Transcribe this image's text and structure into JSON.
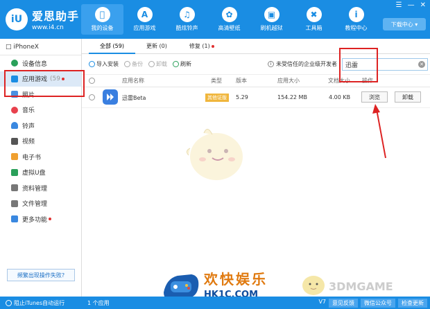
{
  "header": {
    "logo_badge": "iU",
    "logo_title": "爱思助手",
    "logo_url": "www.i4.cn",
    "nav": [
      {
        "label": "我的设备",
        "icon": "apple-icon"
      },
      {
        "label": "应用游戏",
        "icon": "app-store-icon"
      },
      {
        "label": "酷炫铃声",
        "icon": "bell-icon"
      },
      {
        "label": "高清壁纸",
        "icon": "flower-icon"
      },
      {
        "label": "刷机越狱",
        "icon": "box-icon"
      },
      {
        "label": "工具箱",
        "icon": "tools-icon"
      },
      {
        "label": "教程中心",
        "icon": "info-icon"
      }
    ],
    "download_center": "下载中心"
  },
  "sidebar": {
    "device": "iPhoneX",
    "items": [
      {
        "label": "设备信息",
        "icon": "info-icon",
        "color": "#2aa05a"
      },
      {
        "label": "应用游戏",
        "count": "(59",
        "icon": "app-icon",
        "color": "#1a8de3"
      },
      {
        "label": "照片",
        "icon": "photo-icon",
        "color": "#4a90e2"
      },
      {
        "label": "音乐",
        "icon": "music-icon",
        "color": "#e8414d"
      },
      {
        "label": "铃声",
        "icon": "bell-icon",
        "color": "#3a88e0"
      },
      {
        "label": "视频",
        "icon": "video-icon",
        "color": "#555555"
      },
      {
        "label": "电子书",
        "icon": "book-icon",
        "color": "#f0a030"
      },
      {
        "label": "虚拟U盘",
        "icon": "usb-icon",
        "color": "#2aa05a"
      },
      {
        "label": "资料管理",
        "icon": "contacts-icon",
        "color": "#777777"
      },
      {
        "label": "文件管理",
        "icon": "folder-icon",
        "color": "#777777"
      },
      {
        "label": "更多功能",
        "icon": "grid-icon",
        "color": "#3a88e0"
      }
    ],
    "help_button": "频繁出现操作失败?"
  },
  "main": {
    "tabs": [
      {
        "label": "全部 (59)"
      },
      {
        "label": "更新 (0)"
      },
      {
        "label": "修复 (1)"
      }
    ],
    "toolbar": {
      "install": "导入安装",
      "backup": "备份",
      "uninstall": "卸载",
      "refresh": "刷新",
      "untrusted": "未受信任的企业级开发者"
    },
    "search": {
      "value": "迅雷"
    },
    "columns": [
      "应用名称",
      "类型",
      "版本",
      "应用大小",
      "文档大小",
      "操作"
    ],
    "rows": [
      {
        "name": "迅雷Beta",
        "type": "其他证版",
        "version": "5.29",
        "app_size": "154.22 MB",
        "doc_size": "4.00 KB",
        "browse": "浏览",
        "uninstall": "卸载"
      }
    ]
  },
  "statusbar": {
    "itunes": "阻止iTunes自动运行",
    "count": "1 个应用",
    "version": "V7",
    "buttons": [
      "意见反馈",
      "微信公众号",
      "检查更新"
    ]
  },
  "watermark": {
    "cn": "欢快娱乐",
    "en": "HK1C.COM",
    "site": "3DMGAME"
  }
}
